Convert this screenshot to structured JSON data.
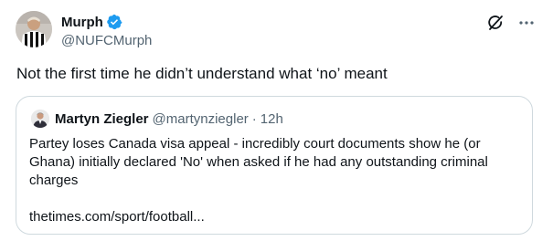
{
  "author": {
    "name": "Murph",
    "handle": "@NUFCMurph"
  },
  "tweet": {
    "text": "Not the first time he didn’t understand what ‘no’ meant"
  },
  "quoted_tweet": {
    "name": "Martyn Ziegler",
    "handle": "@martynziegler",
    "separator": "·",
    "time": "12h",
    "text": "Partey loses Canada visa appeal - incredibly court documents show he (or Ghana) initially declared 'No' when asked if he had any outstanding criminal charges",
    "link": "thetimes.com/sport/football..."
  },
  "icons": {
    "verified": "verified-badge-icon",
    "grok": "grok-icon",
    "more": "more-options-icon"
  },
  "colors": {
    "verified": "#1d9bf0",
    "secondary_text": "#536471",
    "border": "#cfd9de"
  }
}
